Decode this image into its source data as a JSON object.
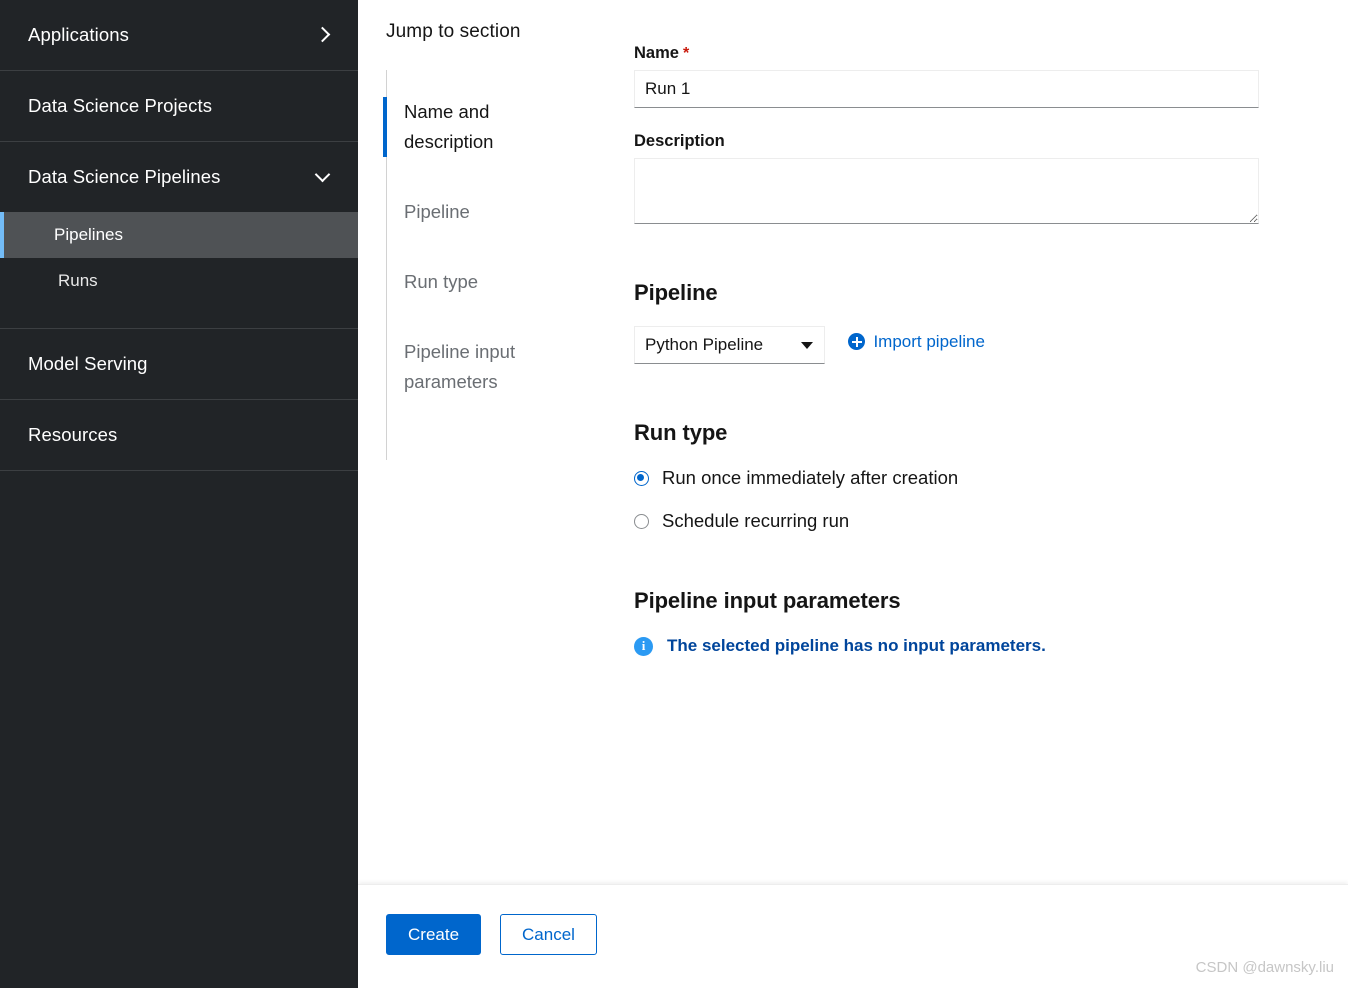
{
  "sidebar": {
    "groups": [
      {
        "label": "Applications",
        "icon": "chevron-right-icon",
        "expandable": true,
        "expanded": false,
        "children": []
      },
      {
        "label": "Data Science Projects",
        "icon": null,
        "expandable": false,
        "expanded": false,
        "children": []
      },
      {
        "label": "Data Science Pipelines",
        "icon": "chevron-down-icon",
        "expandable": true,
        "expanded": true,
        "children": [
          {
            "label": "Pipelines",
            "active": true
          },
          {
            "label": "Runs",
            "active": false
          }
        ]
      },
      {
        "label": "Model Serving",
        "icon": null,
        "expandable": false,
        "expanded": false,
        "children": []
      },
      {
        "label": "Resources",
        "icon": null,
        "expandable": false,
        "expanded": false,
        "children": []
      }
    ]
  },
  "jump": {
    "title": "Jump to section",
    "items": [
      {
        "label_line1": "Name and",
        "label_line2": "description",
        "active": true
      },
      {
        "label_line1": "Pipeline",
        "label_line2": "",
        "active": false
      },
      {
        "label_line1": "Run type",
        "label_line2": "",
        "active": false
      },
      {
        "label_line1": "Pipeline input",
        "label_line2": "parameters",
        "active": false
      }
    ]
  },
  "form": {
    "name": {
      "label": "Name",
      "required_marker": "*",
      "value": "Run 1",
      "placeholder": ""
    },
    "description": {
      "label": "Description",
      "value": "",
      "placeholder": ""
    },
    "pipeline": {
      "section_title": "Pipeline",
      "selected": "Python Pipeline",
      "options": [
        "Python Pipeline"
      ],
      "import_link": "Import pipeline",
      "import_icon": "plus-circle-icon"
    },
    "run_type": {
      "section_title": "Run type",
      "options": [
        {
          "label": "Run once immediately after creation",
          "selected": true
        },
        {
          "label": "Schedule recurring run",
          "selected": false
        }
      ]
    },
    "input_parameters": {
      "section_title": "Pipeline input parameters",
      "info_icon": "info-circle-icon",
      "info_text": "The selected pipeline has no input parameters."
    }
  },
  "footer": {
    "create_label": "Create",
    "cancel_label": "Cancel"
  },
  "watermark": "CSDN @dawnsky.liu",
  "colors": {
    "accent_blue": "#0066cc",
    "sidebar_bg": "#212427",
    "sidebar_active_bg": "#4f5255",
    "sidebar_active_border": "#73bcf7",
    "required_red": "#c9190b",
    "info_blue": "#2b9af3",
    "info_text_blue": "#00459b"
  }
}
